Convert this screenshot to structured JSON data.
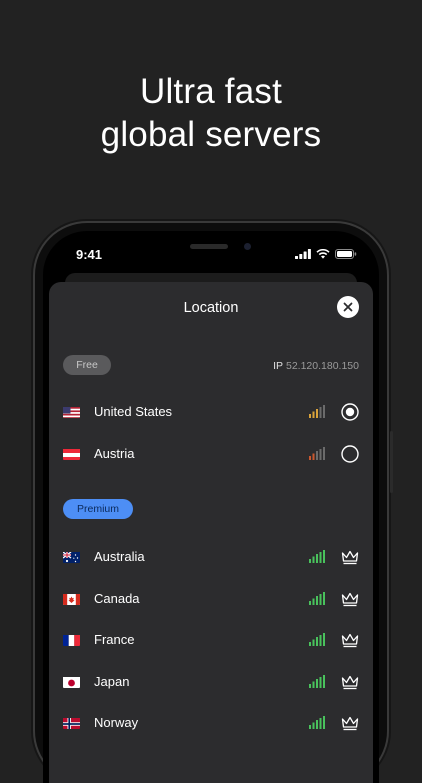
{
  "headline": {
    "line1": "Ultra fast",
    "line2": "global servers"
  },
  "status_bar": {
    "time": "9:41"
  },
  "sheet": {
    "title": "Location"
  },
  "free_section": {
    "badge": "Free",
    "ip_label": "IP",
    "ip_value": "52.120.180.150"
  },
  "premium_section": {
    "badge": "Premium"
  },
  "free_servers": [
    {
      "country": "United States",
      "flag": "us-flag-icon",
      "signal_color": "#d9a23a",
      "selected": true
    },
    {
      "country": "Austria",
      "flag": "at-flag-icon",
      "signal_color": "#c9572f",
      "selected": false
    }
  ],
  "premium_servers": [
    {
      "country": "Australia",
      "flag": "au-flag-icon",
      "signal_color": "#49c25c"
    },
    {
      "country": "Canada",
      "flag": "ca-flag-icon",
      "signal_color": "#49c25c"
    },
    {
      "country": "France",
      "flag": "fr-flag-icon",
      "signal_color": "#49c25c"
    },
    {
      "country": "Japan",
      "flag": "jp-flag-icon",
      "signal_color": "#49c25c"
    },
    {
      "country": "Norway",
      "flag": "no-flag-icon",
      "signal_color": "#49c25c"
    }
  ],
  "colors": {
    "background": "#222222",
    "sheet": "#2c2c2e",
    "premium_accent": "#4d8ef5"
  }
}
